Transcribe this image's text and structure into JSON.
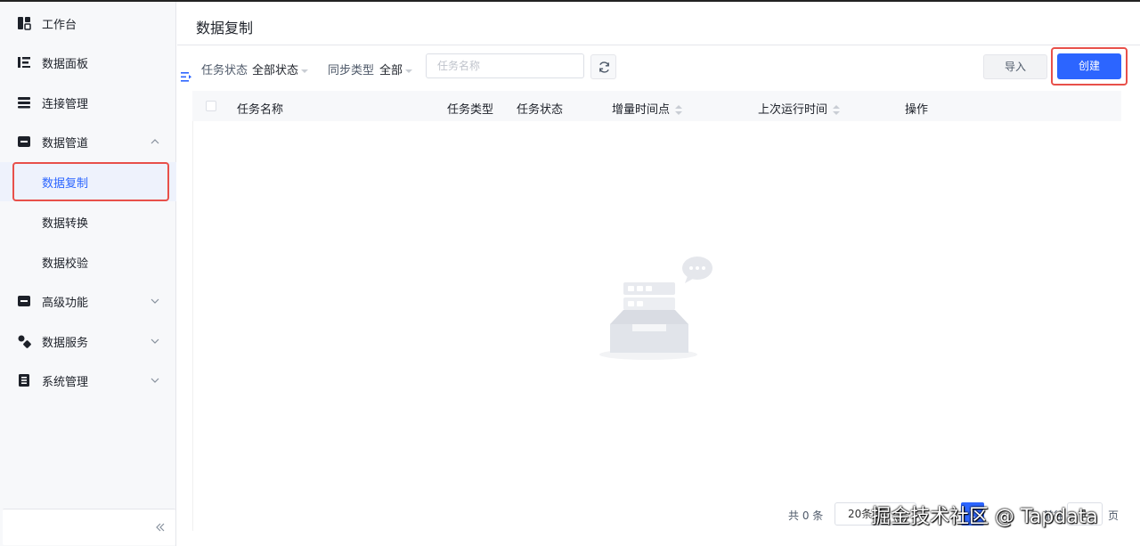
{
  "sidebar": {
    "items": [
      {
        "label": "工作台",
        "icon": "dashboard-icon"
      },
      {
        "label": "数据面板",
        "icon": "data-panel-icon"
      },
      {
        "label": "连接管理",
        "icon": "connection-list-icon"
      },
      {
        "label": "数据管道",
        "icon": "pipeline-icon"
      },
      {
        "label": "数据复制"
      },
      {
        "label": "数据转换"
      },
      {
        "label": "数据校验"
      },
      {
        "label": "高级功能",
        "icon": "advanced-icon"
      },
      {
        "label": "数据服务",
        "icon": "service-icon"
      },
      {
        "label": "系统管理",
        "icon": "system-icon"
      }
    ],
    "collapse_icon": "double-chevron-left-icon"
  },
  "page": {
    "title": "数据复制"
  },
  "filters": {
    "task_status_label": "任务状态",
    "task_status_value": "全部状态",
    "sync_type_label": "同步类型",
    "sync_type_value": "全部",
    "search_placeholder": "任务名称",
    "refresh_icon": "refresh-icon"
  },
  "toolbar": {
    "import_label": "导入",
    "create_label": "创建"
  },
  "table": {
    "columns": [
      "任务名称",
      "任务类型",
      "任务状态",
      "增量时间点",
      "上次运行时间",
      "操作"
    ],
    "rows": []
  },
  "pagination": {
    "total_text": "共 0 条",
    "page_size_text": "20条/页",
    "current_page": "1",
    "goto_label": "前往",
    "goto_value": "1",
    "page_unit": "页"
  },
  "watermark": "掘金技术社区 @ Tapdata",
  "colors": {
    "accent": "#2c65ff",
    "highlight_box": "#e8504a",
    "sidebar_bg": "#f7f8fa",
    "active_bg": "#eef2fc"
  }
}
